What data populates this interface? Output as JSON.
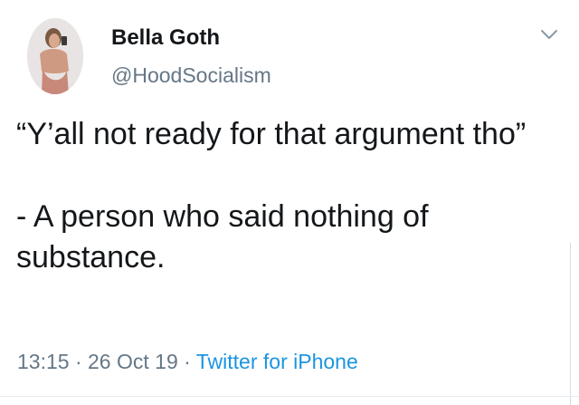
{
  "author": {
    "display_name": "Bella Goth",
    "handle": "@HoodSocialism"
  },
  "tweet": {
    "line_1": "“Y’all not ready for that argument tho”",
    "line_2": "- A person who said nothing of substance."
  },
  "meta": {
    "time": "13:15",
    "sep_1": " · ",
    "date": "26 Oct 19",
    "sep_2": " · ",
    "source": "Twitter for iPhone"
  },
  "colors": {
    "primary_text": "#14171a",
    "secondary_text": "#657786",
    "link": "#1b95e0"
  },
  "icons": {
    "menu": "chevron-down-icon"
  }
}
